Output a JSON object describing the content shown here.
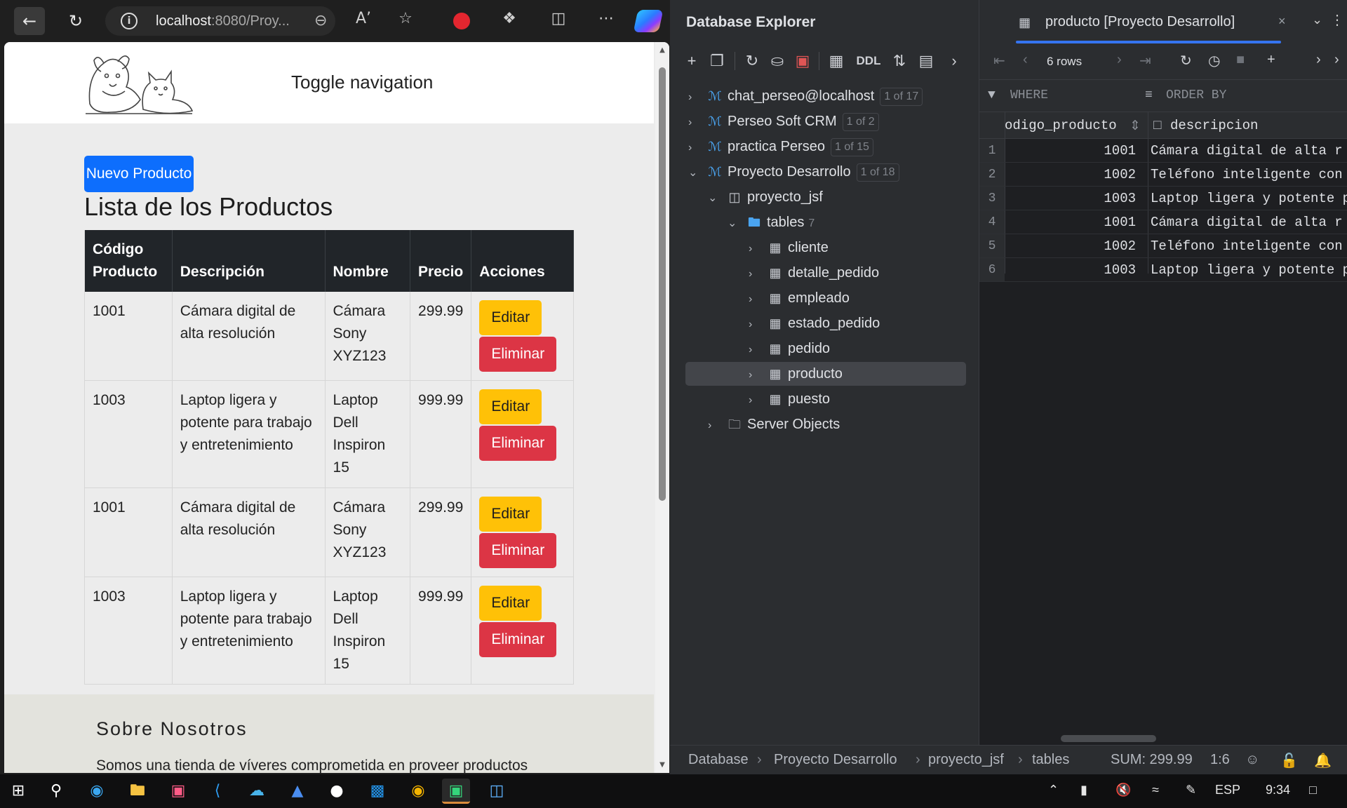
{
  "browser": {
    "url_host": "localhost",
    "url_rest": ":8080/Proy..."
  },
  "site": {
    "toggle_nav": "Toggle navigation",
    "new_button": "Nuevo Producto",
    "list_title": "Lista de los Productos",
    "table_headers": [
      "Código Producto",
      "Descripción",
      "Nombre",
      "Precio",
      "Acciones"
    ],
    "rows": [
      {
        "code": "1001",
        "desc": "Cámara digital de alta resolución",
        "name": "Cámara Sony XYZ123",
        "price": "299.99"
      },
      {
        "code": "1003",
        "desc": "Laptop ligera y potente para trabajo y entretenimiento",
        "name": "Laptop Dell Inspiron 15",
        "price": "999.99"
      },
      {
        "code": "1001",
        "desc": "Cámara digital de alta resolución",
        "name": "Cámara Sony XYZ123",
        "price": "299.99"
      },
      {
        "code": "1003",
        "desc": "Laptop ligera y potente para trabajo y entretenimiento",
        "name": "Laptop Dell Inspiron 15",
        "price": "999.99"
      }
    ],
    "edit_label": "Editar",
    "delete_label": "Eliminar",
    "about_title": "Sobre Nosotros",
    "about_text": "Somos una tienda de víveres comprometida en proveer productos"
  },
  "ide": {
    "explorer_title": "Database Explorer",
    "ddl_label": "DDL",
    "tree": {
      "ds1": {
        "label": "chat_perseo@localhost",
        "badge": "1 of 17"
      },
      "ds2": {
        "label": "Perseo Soft CRM",
        "badge": "1 of 2"
      },
      "ds3": {
        "label": "practica Perseo",
        "badge": "1 of 15"
      },
      "ds4": {
        "label": "Proyecto Desarrollo",
        "badge": "1 of 18"
      },
      "schema": "proyecto_jsf",
      "tables_label": "tables",
      "tables_count": "7",
      "tables": [
        "cliente",
        "detalle_pedido",
        "empleado",
        "estado_pedido",
        "pedido",
        "producto",
        "puesto"
      ],
      "server_objects": "Server Objects"
    },
    "tab_title": "producto [Proyecto Desarrollo]",
    "rows_label": "6 rows",
    "where_label": "WHERE",
    "order_label": "ORDER BY",
    "col_code": "odigo_producto",
    "col_desc": "descripcion",
    "grid_rows": [
      {
        "n": "1",
        "code": "1001",
        "desc": "Cámara digital de alta r"
      },
      {
        "n": "2",
        "code": "1002",
        "desc": "Teléfono inteligente con"
      },
      {
        "n": "3",
        "code": "1003",
        "desc": "Laptop ligera y potente p"
      },
      {
        "n": "4",
        "code": "1001",
        "desc": "Cámara digital de alta r"
      },
      {
        "n": "5",
        "code": "1002",
        "desc": "Teléfono inteligente con"
      },
      {
        "n": "6",
        "code": "1003",
        "desc": "Laptop ligera y potente p"
      }
    ],
    "status": {
      "crumbs": [
        "Database",
        "Proyecto Desarrollo",
        "proyecto_jsf",
        "tables"
      ],
      "sum": "SUM: 299.99",
      "pos": "1:6"
    }
  },
  "taskbar": {
    "lang": "ESP",
    "time": "9:34"
  }
}
